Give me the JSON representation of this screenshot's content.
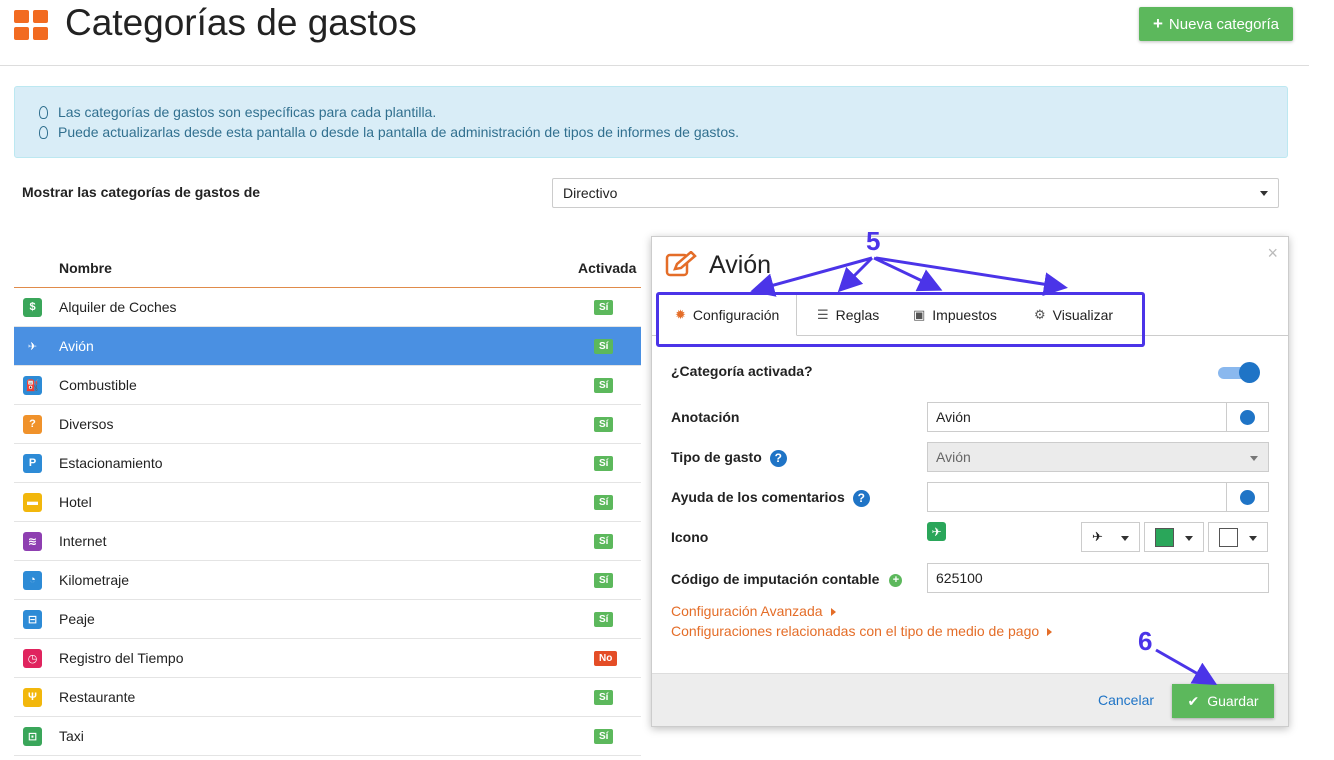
{
  "header": {
    "title": "Categorías de gastos",
    "new_button": "Nueva categoría"
  },
  "info": {
    "lines": [
      "Las categorías de gastos son específicas para cada plantilla.",
      "Puede actualizarlas desde esta pantalla o desde la pantalla de administración de tipos de informes de gastos."
    ]
  },
  "filter": {
    "label": "Mostrar las categorías de gastos de",
    "value": "Directivo"
  },
  "list": {
    "col_name": "Nombre",
    "col_active": "Activada",
    "rows": [
      {
        "name": "Alquiler de Coches",
        "status": "Sí",
        "icon": "car-rental-icon",
        "color": "#3aa65a",
        "glyph": "$"
      },
      {
        "name": "Avión",
        "status": "Sí",
        "icon": "plane-icon",
        "color": "#2aa65a",
        "glyph": "✈",
        "selected": true
      },
      {
        "name": "Combustible",
        "status": "Sí",
        "icon": "fuel-icon",
        "color": "#2d8bd6",
        "glyph": "⛽"
      },
      {
        "name": "Diversos",
        "status": "Sí",
        "icon": "question-icon",
        "color": "#f0922b",
        "glyph": "?"
      },
      {
        "name": "Estacionamiento",
        "status": "Sí",
        "icon": "parking-icon",
        "color": "#2d8bd6",
        "glyph": "P"
      },
      {
        "name": "Hotel",
        "status": "Sí",
        "icon": "bed-icon",
        "color": "#f2b70c",
        "glyph": "▬"
      },
      {
        "name": "Internet",
        "status": "Sí",
        "icon": "wifi-icon",
        "color": "#8e3fb1",
        "glyph": "≋"
      },
      {
        "name": "Kilometraje",
        "status": "Sí",
        "icon": "gauge-icon",
        "color": "#2d8bd6",
        "glyph": "◔"
      },
      {
        "name": "Peaje",
        "status": "Sí",
        "icon": "toll-icon",
        "color": "#2d8bd6",
        "glyph": "⊟"
      },
      {
        "name": "Registro del Tiempo",
        "status": "No",
        "icon": "stopwatch-icon",
        "color": "#e0245e",
        "glyph": "◷"
      },
      {
        "name": "Restaurante",
        "status": "Sí",
        "icon": "cutlery-icon",
        "color": "#f2b70c",
        "glyph": "Ψ"
      },
      {
        "name": "Taxi",
        "status": "Sí",
        "icon": "taxi-icon",
        "color": "#3aa65a",
        "glyph": "⊡"
      }
    ]
  },
  "panel": {
    "title": "Avión",
    "tabs": [
      {
        "label": "Configuración",
        "icon": "gear-icon",
        "glyph": "✹"
      },
      {
        "label": "Reglas",
        "icon": "sliders-icon",
        "glyph": "☰"
      },
      {
        "label": "Impuestos",
        "icon": "money-icon",
        "glyph": "▣"
      },
      {
        "label": "Visualizar",
        "icon": "cogs-icon",
        "glyph": "⚙"
      }
    ],
    "fields": {
      "active_label": "¿Categoría activada?",
      "annotation_label": "Anotación",
      "annotation_value": "Avión",
      "type_label": "Tipo de gasto",
      "type_value": "Avión",
      "comment_help_label": "Ayuda de los comentarios",
      "comment_help_value": "",
      "icon_label": "Icono",
      "code_label": "Código de imputación contable",
      "code_value": "625100"
    },
    "icon_color": "#2aa65a",
    "bg_color": "#ffffff",
    "links": [
      "Configuración Avanzada",
      "Configuraciones relacionadas con el tipo de medio de pago"
    ],
    "cancel": "Cancelar",
    "save": "Guardar"
  },
  "annotations": {
    "tabs_marker": "5",
    "save_marker": "6"
  }
}
